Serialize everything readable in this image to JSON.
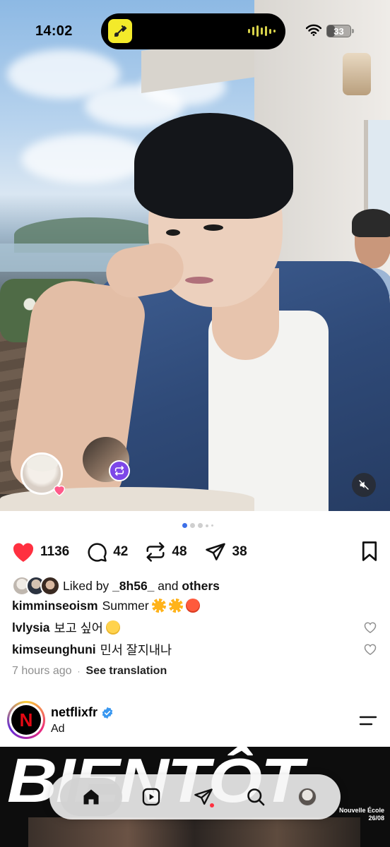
{
  "status_bar": {
    "time": "14:02",
    "battery": "33",
    "battery_level": 0.33
  },
  "post": {
    "media_count": 5,
    "active_index": 0,
    "likes": "1136",
    "comments": "42",
    "reposts": "48",
    "shares": "38",
    "liked_by_prefix": "Liked by",
    "liked_by_user": "_8h56_",
    "liked_by_and": "and",
    "liked_by_others": "others",
    "author": "kimminseoism",
    "caption": "Summer",
    "comments_list": [
      {
        "user": "lvlysia",
        "text": "보고 싶어"
      },
      {
        "user": "kimseunghuni",
        "text": "민서 잘지내나"
      }
    ],
    "time_ago": "7 hours ago",
    "separator": "·",
    "see_translation": "See translation"
  },
  "ad": {
    "account": "netflixfr",
    "logo_letter": "N",
    "label": "Ad",
    "headline": "BIENTÔT",
    "date_line1": "Nouvelle École",
    "date_line2": "26/08"
  },
  "icons": {
    "like": "heart-filled-icon",
    "comment": "comment-bubble-icon",
    "repost": "repost-icon",
    "share": "paper-plane-icon",
    "save": "bookmark-icon",
    "mute": "speaker-muted-icon",
    "verified": "verified-badge-icon",
    "menu": "menu-icon"
  },
  "colors": {
    "like_red": "#ff3040",
    "active_dot": "#3d6fe8",
    "verified_blue": "#3897f0",
    "remix_purple": "#7d47e8",
    "netflix_red": "#e50914"
  },
  "nav": {
    "items": [
      "home",
      "reels",
      "messages",
      "search",
      "profile"
    ],
    "active": "home"
  }
}
